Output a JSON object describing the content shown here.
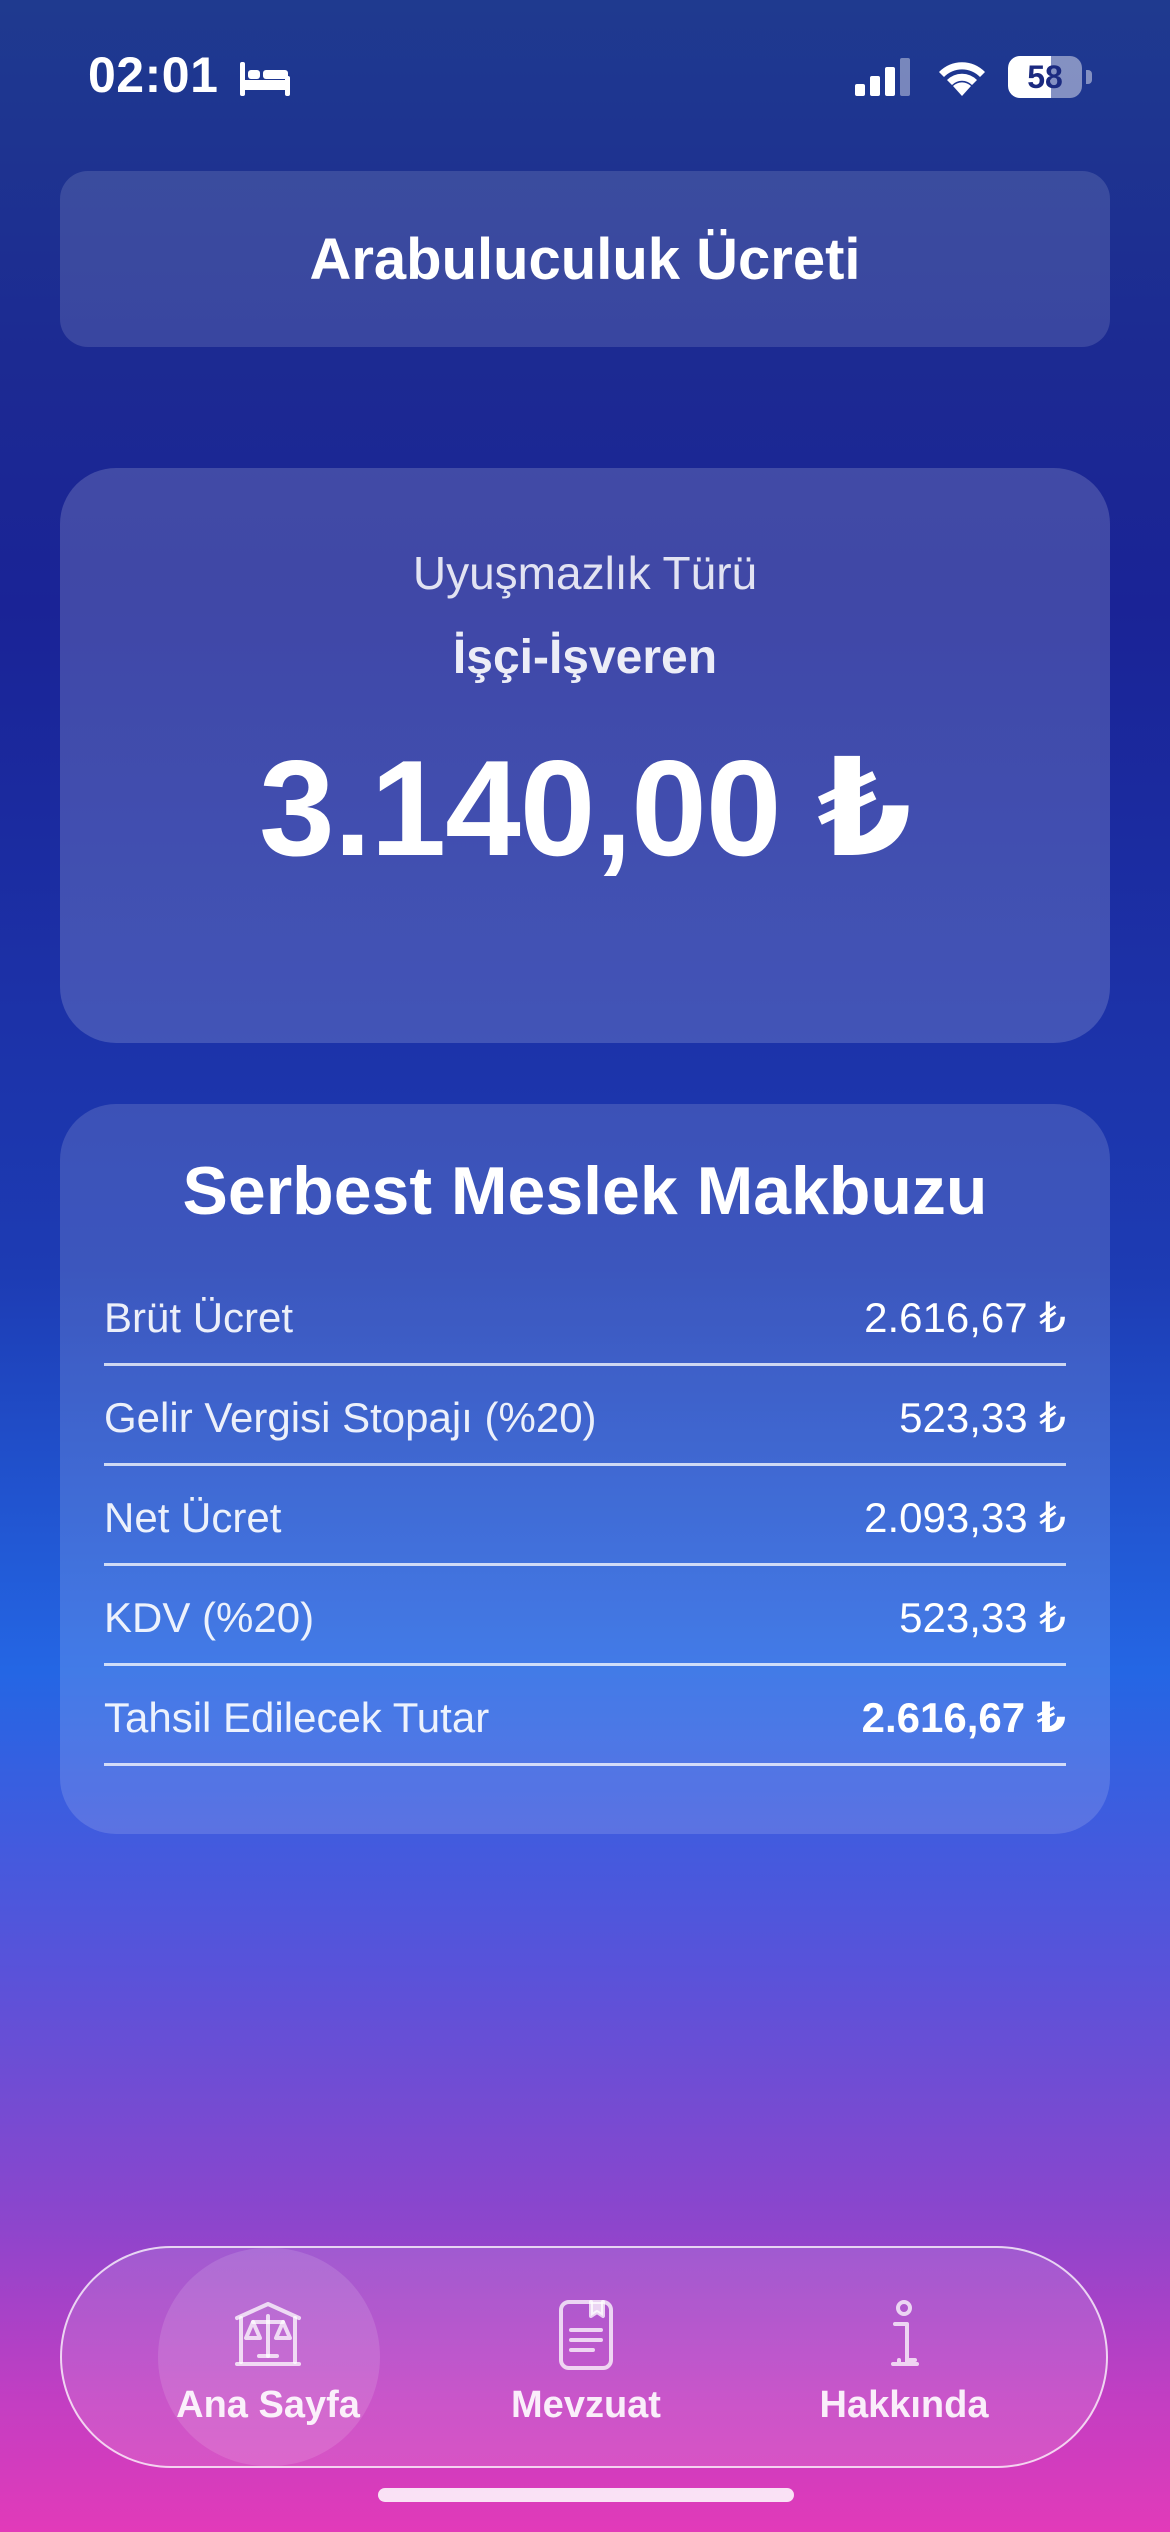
{
  "status_bar": {
    "time": "02:01",
    "battery": "58",
    "battery_level": 0.58,
    "icons": [
      "bed-icon",
      "signal-icon",
      "wifi-icon",
      "battery-icon"
    ]
  },
  "header": {
    "title": "Arabuluculuk Ücreti"
  },
  "amount_card": {
    "label": "Uyuşmazlık Türü",
    "dispute_type": "İşçi-İşveren",
    "amount": "3.140,00 ₺"
  },
  "receipt": {
    "title": "Serbest Meslek Makbuzu",
    "rows": [
      {
        "label": "Brüt Ücret",
        "value": "2.616,67 ₺"
      },
      {
        "label": "Gelir Vergisi Stopajı (%20)",
        "value": "523,33 ₺"
      },
      {
        "label": "Net Ücret",
        "value": "2.093,33 ₺"
      },
      {
        "label": "KDV (%20)",
        "value": "523,33 ₺"
      },
      {
        "label": "Tahsil Edilecek Tutar",
        "value": "2.616,67 ₺"
      }
    ]
  },
  "tab_bar": {
    "items": [
      {
        "label": "Ana Sayfa",
        "icon": "courthouse-scales-icon",
        "active": true
      },
      {
        "label": "Mevzuat",
        "icon": "document-icon",
        "active": false
      },
      {
        "label": "Hakkında",
        "icon": "info-icon",
        "active": false
      }
    ]
  }
}
